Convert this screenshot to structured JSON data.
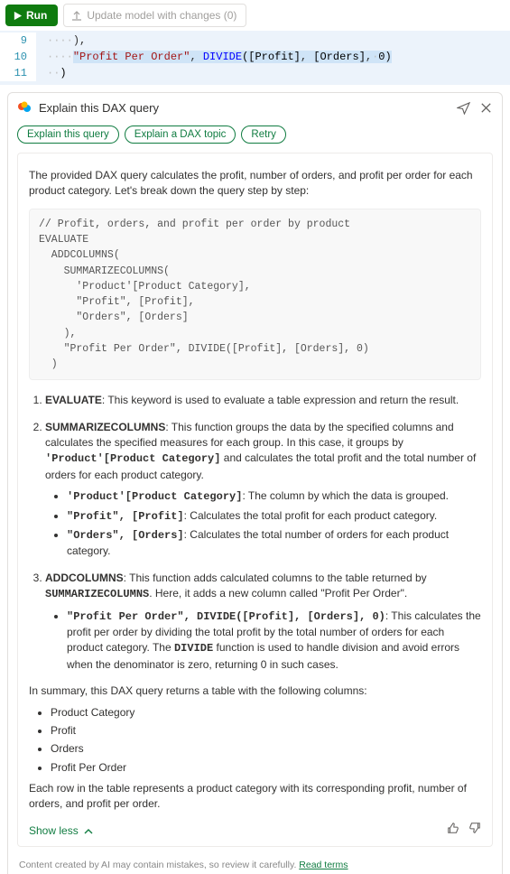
{
  "toolbar": {
    "run_label": "Run",
    "update_label": "Update model with changes (0)"
  },
  "editor": {
    "lines": {
      "l9_num": "9",
      "l10_num": "10",
      "l11_num": "11",
      "l9_trailing": "),",
      "l10_str": "\"Profit Per Order\"",
      "l10_comma1": ", ",
      "l10_func": "DIVIDE",
      "l10_open": "(",
      "l10_arg1": "[Profit]",
      "l10_comma2": ", ",
      "l10_arg2": "[Orders]",
      "l10_comma3": ",",
      "l10_num_arg": "0",
      "l10_close": ")",
      "l11_close": ")"
    }
  },
  "panel": {
    "title": "Explain this DAX query",
    "pills": {
      "explain_query": "Explain this query",
      "explain_topic": "Explain a DAX topic",
      "retry": "Retry"
    },
    "response": {
      "intro": "The provided DAX query calculates the profit, number of orders, and profit per order for each product category. Let's break down the query step by step:",
      "code": "// Profit, orders, and profit per order by product\nEVALUATE\n  ADDCOLUMNS(\n    SUMMARIZECOLUMNS(\n      'Product'[Product Category],\n      \"Profit\", [Profit],\n      \"Orders\", [Orders]\n    ),\n    \"Profit Per Order\", DIVIDE([Profit], [Orders], 0)\n  )",
      "item1_lead": "EVALUATE",
      "item1_rest": ": This keyword is used to evaluate a table expression and return the result.",
      "item2_lead": "SUMMARIZECOLUMNS",
      "item2_rest_a": ": This function groups the data by the specified columns and calculates the specified measures for each group. In this case, it groups by ",
      "item2_mono": "'Product'[Product Category]",
      "item2_rest_b": " and calculates the total profit and the total number of orders for each product category.",
      "item2_b1_mono": "'Product'[Product Category]",
      "item2_b1_rest": ": The column by which the data is grouped.",
      "item2_b2_mono": "\"Profit\", [Profit]",
      "item2_b2_rest": ": Calculates the total profit for each product category.",
      "item2_b3_mono": "\"Orders\", [Orders]",
      "item2_b3_rest": ": Calculates the total number of orders for each product category.",
      "item3_lead": "ADDCOLUMNS",
      "item3_rest_a": ": This function adds calculated columns to the table returned by ",
      "item3_mono": "SUMMARIZECOLUMNS",
      "item3_rest_b": ". Here, it adds a new column called \"Profit Per Order\".",
      "item3_b1_mono": "\"Profit Per Order\", DIVIDE([Profit], [Orders], 0)",
      "item3_b1_rest_a": ": This calculates the profit per order by dividing the total profit by the total number of orders for each product category. The ",
      "item3_b1_mono2": "DIVIDE",
      "item3_b1_rest_b": " function is used to handle division and avoid errors when the denominator is zero, returning 0 in such cases.",
      "summary_intro": "In summary, this DAX query returns a table with the following columns:",
      "sum_b1": "Product Category",
      "sum_b2": "Profit",
      "sum_b3": "Orders",
      "sum_b4": "Profit Per Order",
      "closing": "Each row in the table represents a product category with its corresponding profit, number of orders, and profit per order.",
      "show_less": "Show less"
    },
    "disclaimer": {
      "text": "Content created by AI may contain mistakes, so review it carefully. ",
      "link": "Read terms"
    }
  }
}
